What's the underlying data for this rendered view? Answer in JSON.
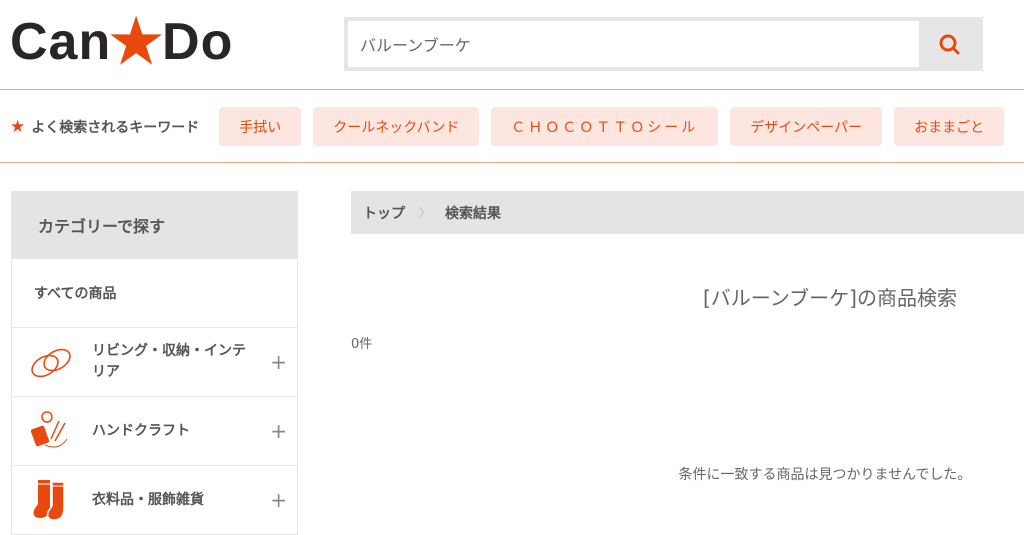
{
  "header": {
    "logo_text": "Can★Do",
    "search": {
      "value": "バルーンブーケ",
      "button_icon": "search-icon"
    }
  },
  "keywords": {
    "label": "よく検索されるキーワード",
    "items": [
      "手拭い",
      "クールネックバンド",
      "ＣＨＯＣＯＴＴＯシール",
      "デザインペーパー",
      "おままごと"
    ]
  },
  "sidebar": {
    "title": "カテゴリーで探す",
    "all_label": "すべての商品",
    "items": [
      {
        "label": "リビング・収納・インテリア",
        "icon": "slippers-icon"
      },
      {
        "label": "ハンドクラフト",
        "icon": "sewing-icon"
      },
      {
        "label": "衣料品・服飾雑貨",
        "icon": "socks-icon"
      }
    ],
    "expand_symbol": "+"
  },
  "breadcrumb": {
    "top": "トップ",
    "separator": "〉",
    "current": "検索結果"
  },
  "results": {
    "title": "[バルーンブーケ]の商品検索",
    "count": "0件",
    "empty_message": "条件に一致する商品は見つかりませんでした。"
  },
  "colors": {
    "accent": "#e8490f",
    "chip_bg": "#fde6df",
    "panel_gray": "#e4e4e4"
  }
}
